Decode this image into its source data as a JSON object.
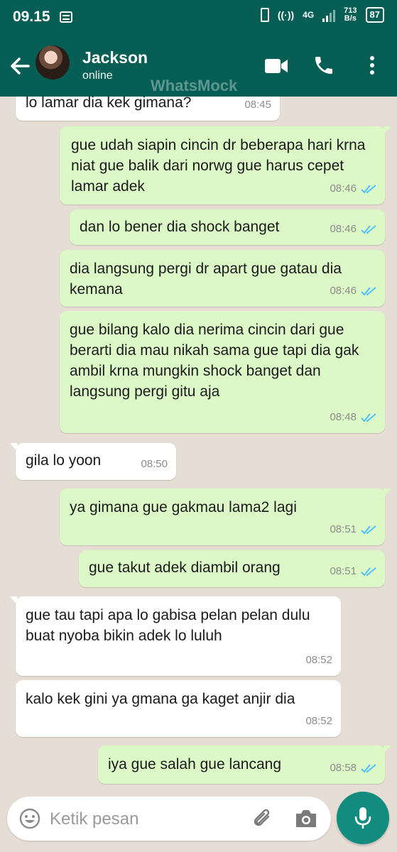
{
  "status_bar": {
    "time": "09.15",
    "net_speed_value": "713",
    "net_speed_unit": "B/s",
    "signal_label": "4G",
    "battery": "87"
  },
  "header": {
    "contact_name": "Jackson",
    "contact_status": "online",
    "watermark": "WhatsMock"
  },
  "messages": [
    {
      "dir": "in",
      "text": "lo lamar dia kek gimana?",
      "time": "08:45"
    },
    {
      "dir": "out",
      "text": "gue udah siapin cincin dr beberapa hari krna niat gue balik dari norwg gue harus cepet lamar adek",
      "time": "08:46"
    },
    {
      "dir": "out",
      "text": "dan lo bener dia shock banget",
      "time": "08:46"
    },
    {
      "dir": "out",
      "text": "dia langsung pergi dr apart gue gatau dia kemana",
      "time": "08:46"
    },
    {
      "dir": "out",
      "text": "gue bilang kalo dia nerima cincin dari gue berarti dia mau nikah sama gue tapi dia gak ambil krna mungkin shock banget dan langsung pergi gitu aja",
      "time": "08:48"
    },
    {
      "dir": "in",
      "text": "gila lo yoon",
      "time": "08:50"
    },
    {
      "dir": "out",
      "text": "ya gimana gue gakmau lama2 lagi",
      "time": "08:51"
    },
    {
      "dir": "out",
      "text": "gue takut adek diambil orang",
      "time": "08:51"
    },
    {
      "dir": "in",
      "text": "gue tau tapi apa lo gabisa pelan pelan dulu buat nyoba bikin adek lo luluh",
      "time": "08:52"
    },
    {
      "dir": "in",
      "text": "kalo kek gini ya gmana ga kaget anjir dia",
      "time": "08:52"
    },
    {
      "dir": "out",
      "text": "iya gue salah gue lancang",
      "time": "08:58"
    }
  ],
  "composer": {
    "placeholder": "Ketik pesan"
  },
  "colors": {
    "header": "#075e54",
    "outgoing_bubble": "#dcf8c6",
    "incoming_bubble": "#ffffff",
    "read_ticks": "#4fc3f7",
    "mic_button": "#128c7e"
  }
}
